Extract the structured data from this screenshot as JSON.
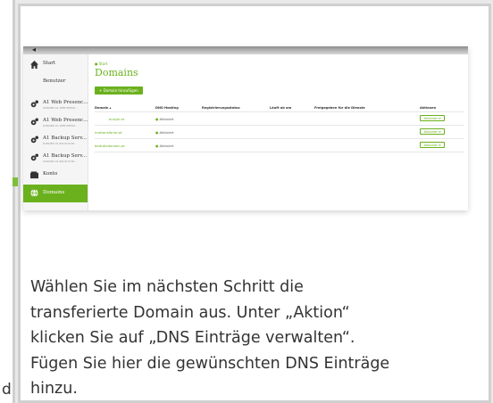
{
  "left_fragment": "d",
  "colors": {
    "brand_green": "#6bb11e",
    "arrow_green": "#7dbf3a"
  },
  "screenshot": {
    "sidebar": {
      "items": [
        {
          "label": "Start",
          "icon": "home-icon"
        },
        {
          "label": "Benutzer"
        },
        {
          "label": "A1 Web Presenc...",
          "sub": "KUNDEN 01 WEB PRESE...",
          "icon": "gears-icon"
        },
        {
          "label": "A1 Web Presenc...",
          "sub": "KUNDEN 01 WEB PRESE...",
          "icon": "gears-icon"
        },
        {
          "label": "A1 Backup Serv...",
          "sub": "KUNDEN 01 BACKUP SE...",
          "icon": "gears-icon"
        },
        {
          "label": "A1 Backup Serv...",
          "sub": "KUNDEN 01 BACKUP SE...",
          "icon": "gears-icon"
        },
        {
          "label": "Konto",
          "icon": "wallet-icon"
        },
        {
          "label": "Domains",
          "icon": "globe-icon",
          "active": true
        }
      ]
    },
    "breadcrumb": "● Start",
    "title": "Domains",
    "add_button": "+ Domain hinzufügen",
    "table": {
      "columns": [
        "Domain ▴",
        "DNS-Hosting",
        "Registrierungsstatus",
        "Läuft ab am",
        "Freigegeben für die Dienste",
        "Aktionen"
      ],
      "rows": [
        {
          "domain": "burgin.at",
          "dns": "Aktiviert",
          "action": "Aktionen ▾"
        },
        {
          "domain": "irrationsfante.at",
          "dns": "Aktiviert",
          "action": "Aktionen ▾"
        },
        {
          "domain": "beitrdledomain.at",
          "dns": "Aktiviert",
          "action": "Aktionen ▾"
        }
      ]
    }
  },
  "caption_lines": [
    "Wählen Sie im nächsten Schritt die",
    "transferierte Domain aus. Unter „Aktion“",
    "klicken Sie auf „DNS Einträge verwalten“.",
    "Fügen Sie hier die gewünschten DNS Einträge",
    "hinzu."
  ]
}
